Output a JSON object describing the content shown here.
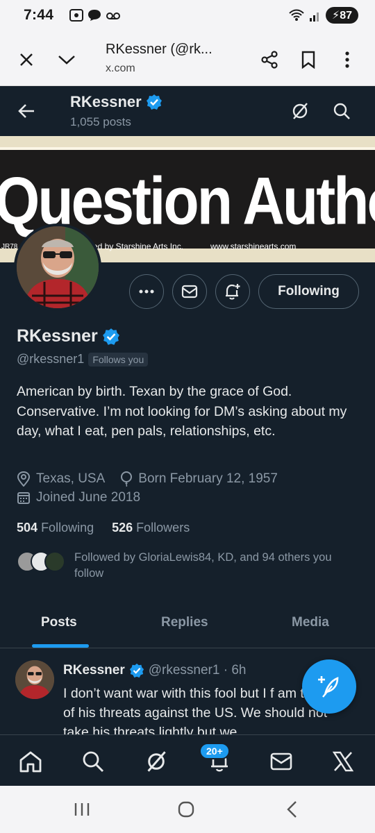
{
  "status_bar": {
    "time": "7:44",
    "battery": "87"
  },
  "tab_toolbar": {
    "title": "RKessner (@rk...",
    "url": "x.com"
  },
  "header": {
    "name": "RKessner",
    "posts_count": "1,055 posts"
  },
  "banner": {
    "headline": "Question Authority",
    "credit": "red by Starshine Arts Inc.",
    "url": "www.starshinearts.com",
    "code": "JR78"
  },
  "profile": {
    "follow_button": "Following",
    "name": "RKessner",
    "handle": "@rkessner1",
    "follows_you": "Follows you",
    "bio": "American by birth. Texan by the grace of God. Conservative.  I’m not looking for DM’s asking about my day, what I eat, pen pals, relationships, etc.",
    "location": "Texas, USA",
    "born": "Born February 12, 1957",
    "joined": "Joined June 2018",
    "following_count": "504",
    "following_label": "Following",
    "followers_count": "526",
    "followers_label": "Followers",
    "followed_by": "Followed by GloriaLewis84, KD, and 94 others you follow"
  },
  "tabs": [
    {
      "label": "Posts"
    },
    {
      "label": "Replies"
    },
    {
      "label": "Media"
    }
  ],
  "post": {
    "name": "RKessner",
    "handle_time": "@rkessner1 · 6h",
    "text": "I don’t want war with this fool but I f am tired of his threats against the US. We should not take his threats lightly but we"
  },
  "bottom_nav": {
    "notification_badge": "20+"
  },
  "colors": {
    "background": "#15202b",
    "accent": "#1d9bf0",
    "secondary_text": "#8b98a5"
  }
}
